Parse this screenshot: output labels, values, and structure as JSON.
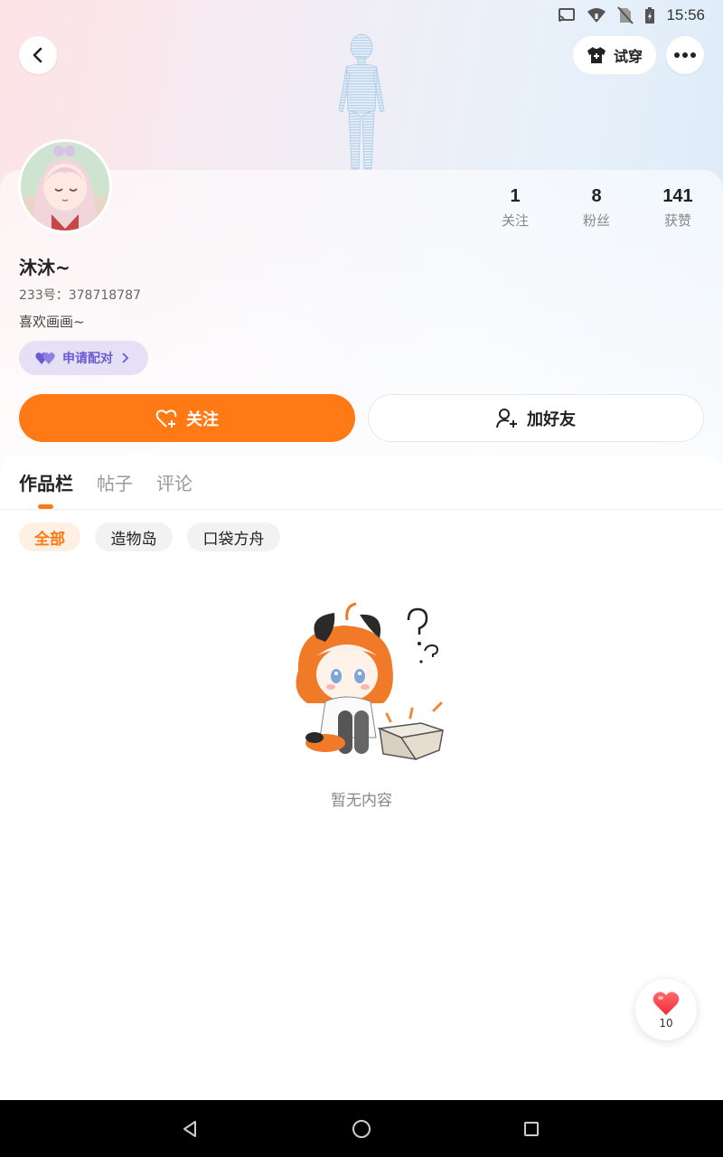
{
  "status_bar": {
    "time": "15:56",
    "icons": [
      "cast-icon",
      "wifi-icon",
      "no-sim-icon",
      "battery-charging-icon"
    ]
  },
  "header": {
    "back_icon": "chevron-left-icon",
    "tryon_label": "试穿",
    "tryon_icon": "tshirt-icon",
    "more_icon": "more-horizontal-icon"
  },
  "profile": {
    "name": "沐沐~",
    "uid": "233号：378718787",
    "bio": "喜欢画画~",
    "pair_label": "申请配对",
    "stats": [
      {
        "value": "1",
        "label": "关注"
      },
      {
        "value": "8",
        "label": "粉丝"
      },
      {
        "value": "141",
        "label": "获赞"
      }
    ]
  },
  "actions": {
    "follow_label": "关注",
    "add_friend_label": "加好友"
  },
  "tabs": [
    {
      "label": "作品栏",
      "active": true
    },
    {
      "label": "帖子",
      "active": false
    },
    {
      "label": "评论",
      "active": false
    }
  ],
  "filters": [
    {
      "label": "全部",
      "active": true
    },
    {
      "label": "造物岛",
      "active": false
    },
    {
      "label": "口袋方舟",
      "active": false
    }
  ],
  "empty_state": {
    "text": "暂无内容"
  },
  "like_fab": {
    "count": "10"
  },
  "colors": {
    "accent": "#ff7a14",
    "pair_chip_bg": "#e5e0f5",
    "pair_chip_text": "#6a5bd1"
  }
}
